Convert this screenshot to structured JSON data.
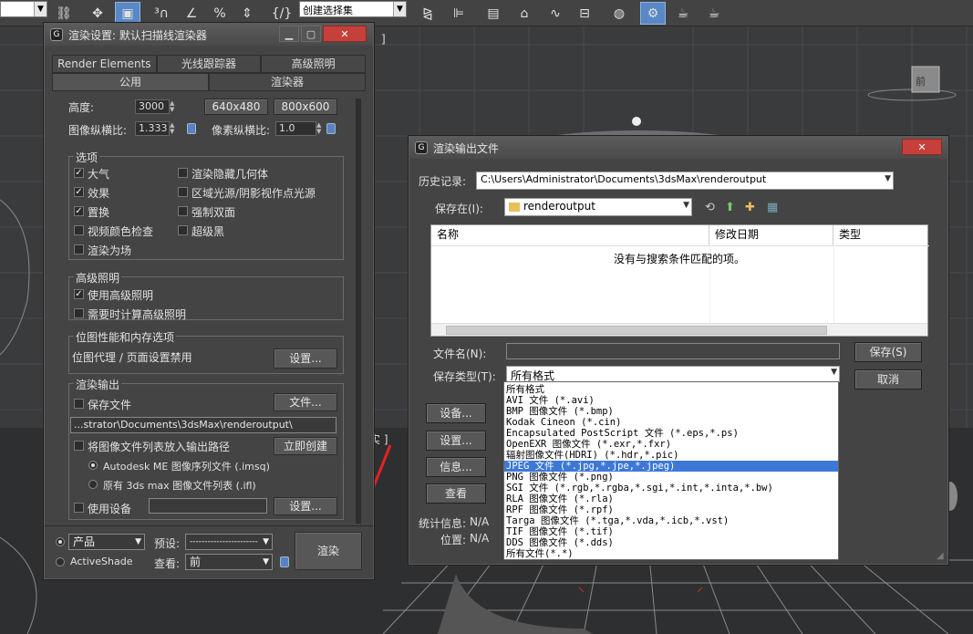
{
  "toolbar": {
    "selection_set_placeholder": "创建选择集"
  },
  "viewport": {
    "cube_label": "前",
    "partial_text": "实 ]",
    "bracket_text": "]"
  },
  "render_setup": {
    "title": "渲染设置: 默认扫描线渲染器",
    "tabs_row1": [
      "Render Elements",
      "光线跟踪器",
      "高级照明"
    ],
    "tabs_row2": [
      "公用",
      "渲染器"
    ],
    "height_label": "高度:",
    "height_value": "3000",
    "preset_640": "640x480",
    "preset_800": "800x600",
    "aspect_label": "图像纵横比:",
    "aspect_value": "1.333",
    "pixel_aspect_label": "像素纵横比:",
    "pixel_aspect_value": "1.0",
    "options": {
      "title": "选项",
      "atmosphere": "大气",
      "effects": "效果",
      "displacement": "置换",
      "video_check": "视频颜色检查",
      "render_fields": "渲染为场",
      "render_hidden": "渲染隐藏几何体",
      "area_lights": "区域光源/阴影视作点光源",
      "force_2sided": "强制双面",
      "super_black": "超级黑"
    },
    "adv_lighting": {
      "title": "高级照明",
      "use": "使用高级照明",
      "compute": "需要时计算高级照明"
    },
    "bitmap": {
      "title": "位图性能和内存选项",
      "text": "位图代理 / 页面设置禁用",
      "setup_btn": "设置..."
    },
    "render_output": {
      "title": "渲染输出",
      "save_file": "保存文件",
      "files_btn": "文件...",
      "path": "...strator\\Documents\\3dsMax\\renderoutput\\",
      "put_list": "将图像文件列表放入输出路径",
      "create_now": "立即创建",
      "autodesk_me": "Autodesk ME 图像序列文件 (.imsq)",
      "legacy": "原有 3ds max 图像文件列表 (.ifl)",
      "use_device": "使用设备",
      "device_btn": "设置..."
    },
    "bottom": {
      "product": "产品",
      "activeshade": "ActiveShade",
      "preset_label": "预设:",
      "preset_value": "-----------------------",
      "view_label": "查看:",
      "view_value": "前",
      "render_btn": "渲染"
    }
  },
  "save_dialog": {
    "title": "渲染输出文件",
    "history_label": "历史记录:",
    "history_value": "C:\\Users\\Administrator\\Documents\\3dsMax\\renderoutput",
    "save_in_label": "保存在(I):",
    "save_in_value": "renderoutput",
    "columns": [
      "名称",
      "修改日期",
      "类型"
    ],
    "empty_msg": "没有与搜索条件匹配的项。",
    "filename_label": "文件名(N):",
    "filename_value": "",
    "type_label": "保存类型(T):",
    "type_value": "所有格式",
    "save_btn": "保存(S)",
    "cancel_btn": "取消",
    "left_buttons": [
      "设备...",
      "设置...",
      "信息...",
      "查看"
    ],
    "stats_label": "统计信息:",
    "stats_value": "N/A",
    "location_label": "位置:",
    "location_value": "N/A",
    "type_options": [
      "所有格式",
      "AVI 文件 (*.avi)",
      "BMP 图像文件 (*.bmp)",
      "Kodak Cineon (*.cin)",
      "Encapsulated PostScript 文件 (*.eps,*.ps)",
      "OpenEXR 图像文件 (*.exr,*.fxr)",
      "辐射图像文件(HDRI) (*.hdr,*.pic)",
      "JPEG 文件 (*.jpg,*.jpe,*.jpeg)",
      "PNG 图像文件 (*.png)",
      "SGI 文件 (*.rgb,*.rgba,*.sgi,*.int,*.inta,*.bw)",
      "RLA 图像文件 (*.rla)",
      "RPF 图像文件 (*.rpf)",
      "Targa 图像文件 (*.tga,*.vda,*.icb,*.vst)",
      "TIF 图像文件 (*.tif)",
      "DDS 图像文件 (*.dds)",
      "所有文件(*.*)"
    ],
    "highlighted_option": 7
  }
}
